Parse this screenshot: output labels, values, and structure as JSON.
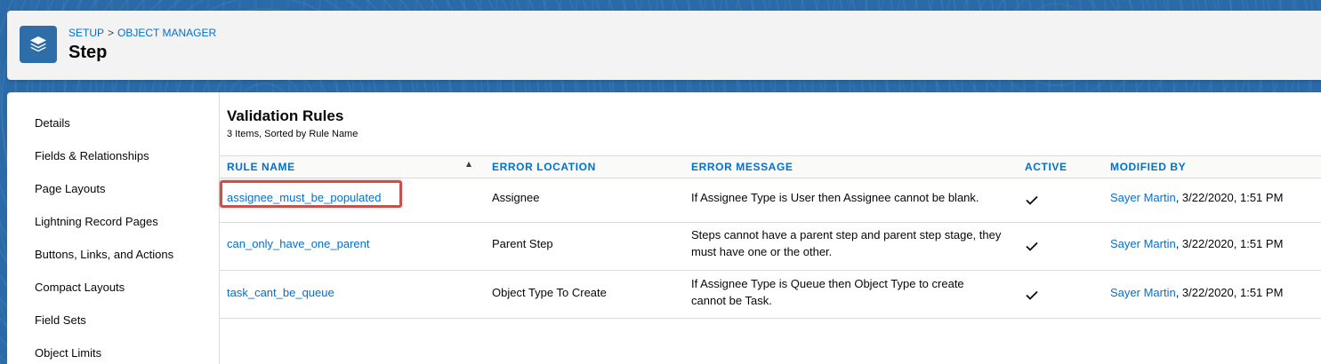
{
  "header": {
    "breadcrumb": [
      "SETUP",
      "OBJECT MANAGER"
    ],
    "breadcrumb_sep": ">",
    "title": "Step",
    "icon": "layers-icon"
  },
  "sidebar": {
    "items": [
      {
        "label": "Details"
      },
      {
        "label": "Fields & Relationships"
      },
      {
        "label": "Page Layouts"
      },
      {
        "label": "Lightning Record Pages"
      },
      {
        "label": "Buttons, Links, and Actions"
      },
      {
        "label": "Compact Layouts"
      },
      {
        "label": "Field Sets"
      },
      {
        "label": "Object Limits"
      }
    ]
  },
  "main": {
    "title": "Validation Rules",
    "subtitle": "3 Items, Sorted by Rule Name",
    "columns": [
      "RULE NAME",
      "ERROR LOCATION",
      "ERROR MESSAGE",
      "ACTIVE",
      "MODIFIED BY"
    ],
    "rows": [
      {
        "rule_name": "assignee_must_be_populated",
        "error_location": "Assignee",
        "error_message": "If Assignee Type is User then Assignee cannot be blank.",
        "active": true,
        "modified_by_user": "Sayer Martin",
        "modified_by_date": ", 3/22/2020, 1:51 PM"
      },
      {
        "rule_name": "can_only_have_one_parent",
        "error_location": "Parent Step",
        "error_message": "Steps cannot have a parent step and parent step stage, they must have one or the other.",
        "active": true,
        "modified_by_user": "Sayer Martin",
        "modified_by_date": ", 3/22/2020, 1:51 PM"
      },
      {
        "rule_name": "task_cant_be_queue",
        "error_location": "Object Type To Create",
        "error_message": "If Assignee Type is Queue then Object Type to create cannot be Task.",
        "active": true,
        "modified_by_user": "Sayer Martin",
        "modified_by_date": ", 3/22/2020, 1:51 PM"
      }
    ]
  },
  "colors": {
    "link": "#0070d2",
    "brand_icon": "#2e6ea8",
    "highlight": "#e0483e"
  }
}
